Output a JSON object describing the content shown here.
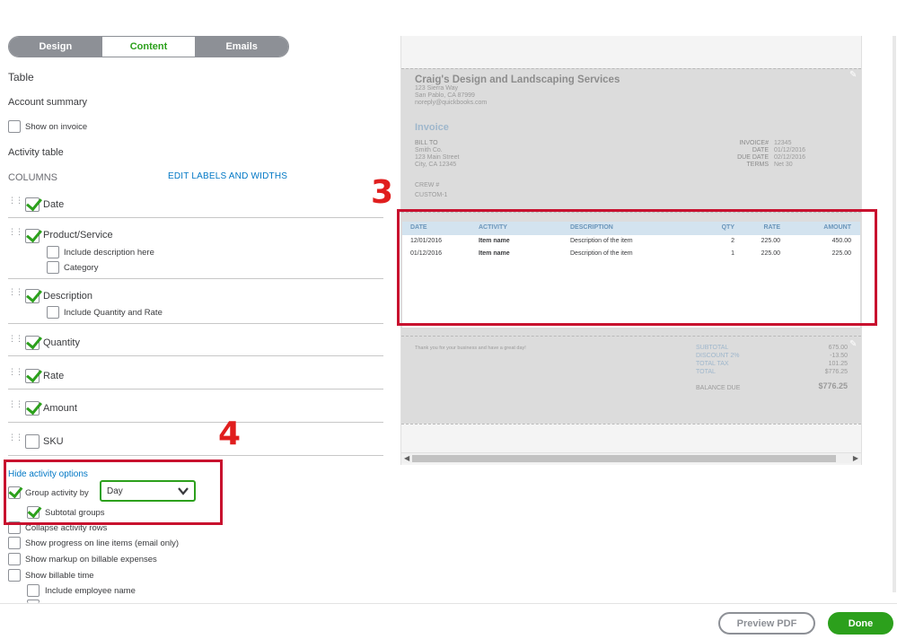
{
  "tabs": [
    "Design",
    "Content",
    "Emails"
  ],
  "left": {
    "table_heading": "Table",
    "account_summary": "Account summary",
    "show_on_invoice": "Show on invoice",
    "activity_table": "Activity table",
    "columns": "COLUMNS",
    "edit_labels": "EDIT LABELS AND WIDTHS",
    "col_date": "Date",
    "col_product": "Product/Service",
    "include_description": "Include description here",
    "category": "Category",
    "col_description": "Description",
    "include_qty_rate": "Include Quantity and Rate",
    "col_quantity": "Quantity",
    "col_rate": "Rate",
    "col_amount": "Amount",
    "col_sku": "SKU",
    "hide_activity_options": "Hide activity options",
    "group_activity_by": "Group activity by",
    "group_value": "Day",
    "subtotal_groups": "Subtotal groups",
    "collapse_rows": "Collapse activity rows",
    "show_progress": "Show progress on line items (email only)",
    "show_markup": "Show markup on billable expenses",
    "show_billable_time": "Show billable time",
    "include_employee": "Include employee name"
  },
  "annotations": {
    "three": "3",
    "four": "4"
  },
  "invoice": {
    "company": "Craig's Design and Landscaping Services",
    "address1": "123 Sierra Way",
    "address2": "San Pablo, CA 87999",
    "email": "noreply@quickbooks.com",
    "title": "Invoice",
    "bill_to": "BILL TO",
    "bill_name": "Smith Co.",
    "bill_street": "123 Main Street",
    "bill_city": "City, CA 12345",
    "crew": "CREW #",
    "custom": "CUSTOM-1",
    "invoice_no_label": "INVOICE#",
    "invoice_no": "12345",
    "date_label": "DATE",
    "date": "01/12/2016",
    "due_label": "DUE DATE",
    "due": "02/12/2016",
    "terms_label": "TERMS",
    "terms": "Net 30",
    "headers": [
      "DATE",
      "ACTIVITY",
      "DESCRIPTION",
      "QTY",
      "RATE",
      "AMOUNT"
    ],
    "rows": [
      [
        "12/01/2016",
        "Item name",
        "Description of the item",
        "2",
        "225.00",
        "450.00"
      ],
      [
        "01/12/2016",
        "Item name",
        "Description of the item",
        "1",
        "225.00",
        "225.00"
      ]
    ],
    "thanks": "Thank you for your business and have a great day!",
    "subtotal_label": "SUBTOTAL",
    "subtotal": "675.00",
    "discount_label": "DISCOUNT 2%",
    "discount": "-13.50",
    "total_tax_label": "TOTAL TAX",
    "total_tax": "101.25",
    "total_label": "TOTAL",
    "total": "$776.25",
    "balance_label": "BALANCE DUE",
    "balance": "$776.25"
  },
  "footer": {
    "preview_pdf": "Preview PDF",
    "done": "Done"
  },
  "colors": {
    "accent": "#2ca01c",
    "link": "#0077c5",
    "annotation": "#c8102e"
  }
}
